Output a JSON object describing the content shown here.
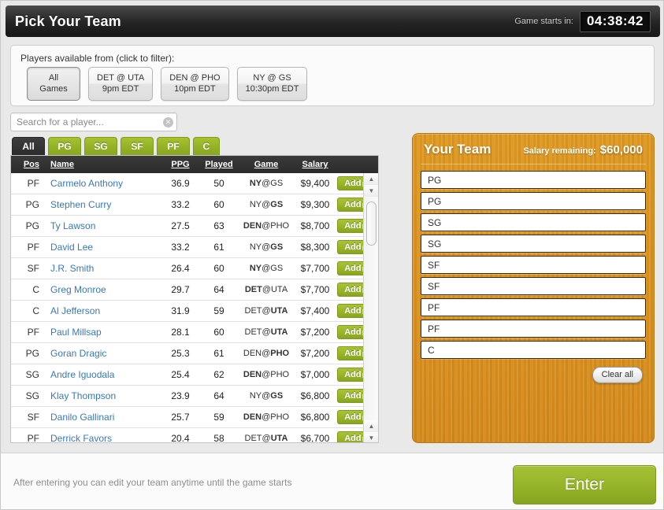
{
  "header": {
    "title": "Pick Your Team",
    "timer_label": "Game starts in:",
    "timer_value": "04:38:42"
  },
  "games_filter": {
    "label": "Players available from (click to filter):",
    "buttons": [
      {
        "line1": "All",
        "line2": "Games",
        "active": true
      },
      {
        "line1": "DET @ UTA",
        "line2": "9pm EDT",
        "active": false
      },
      {
        "line1": "DEN @ PHO",
        "line2": "10pm EDT",
        "active": false
      },
      {
        "line1": "NY @ GS",
        "line2": "10:30pm EDT",
        "active": false
      }
    ]
  },
  "search": {
    "placeholder": "Search for a player...",
    "value": "",
    "clear_icon": "clear-icon"
  },
  "position_tabs": [
    {
      "label": "All",
      "active": true
    },
    {
      "label": "PG",
      "active": false
    },
    {
      "label": "SG",
      "active": false
    },
    {
      "label": "SF",
      "active": false
    },
    {
      "label": "PF",
      "active": false
    },
    {
      "label": "C",
      "active": false
    }
  ],
  "table": {
    "columns": [
      "Pos",
      "Name",
      "PPG",
      "Played",
      "Game",
      "Salary"
    ],
    "add_label": "Add",
    "rows": [
      {
        "pos": "PF",
        "name": "Carmelo Anthony",
        "ppg": "36.9",
        "played": "50",
        "game_away": "NY",
        "game_home": "GS",
        "bold": "away",
        "salary": "$9,400"
      },
      {
        "pos": "PG",
        "name": "Stephen Curry",
        "ppg": "33.2",
        "played": "60",
        "game_away": "NY",
        "game_home": "GS",
        "bold": "home",
        "salary": "$9,300"
      },
      {
        "pos": "PG",
        "name": "Ty Lawson",
        "ppg": "27.5",
        "played": "63",
        "game_away": "DEN",
        "game_home": "PHO",
        "bold": "away",
        "salary": "$8,700"
      },
      {
        "pos": "PF",
        "name": "David Lee",
        "ppg": "33.2",
        "played": "61",
        "game_away": "NY",
        "game_home": "GS",
        "bold": "home",
        "salary": "$8,300"
      },
      {
        "pos": "SF",
        "name": "J.R. Smith",
        "ppg": "26.4",
        "played": "60",
        "game_away": "NY",
        "game_home": "GS",
        "bold": "away",
        "salary": "$7,700"
      },
      {
        "pos": "C",
        "name": "Greg Monroe",
        "ppg": "29.7",
        "played": "64",
        "game_away": "DET",
        "game_home": "UTA",
        "bold": "away",
        "salary": "$7,700"
      },
      {
        "pos": "C",
        "name": "Al Jefferson",
        "ppg": "31.9",
        "played": "59",
        "game_away": "DET",
        "game_home": "UTA",
        "bold": "home",
        "salary": "$7,400"
      },
      {
        "pos": "PF",
        "name": "Paul Millsap",
        "ppg": "28.1",
        "played": "60",
        "game_away": "DET",
        "game_home": "UTA",
        "bold": "home",
        "salary": "$7,200"
      },
      {
        "pos": "PG",
        "name": "Goran Dragic",
        "ppg": "25.3",
        "played": "61",
        "game_away": "DEN",
        "game_home": "PHO",
        "bold": "home",
        "salary": "$7,200"
      },
      {
        "pos": "SG",
        "name": "Andre Iguodala",
        "ppg": "25.4",
        "played": "62",
        "game_away": "DEN",
        "game_home": "PHO",
        "bold": "away",
        "salary": "$7,000"
      },
      {
        "pos": "SG",
        "name": "Klay Thompson",
        "ppg": "23.9",
        "played": "64",
        "game_away": "NY",
        "game_home": "GS",
        "bold": "home",
        "salary": "$6,800"
      },
      {
        "pos": "SF",
        "name": "Danilo Gallinari",
        "ppg": "25.7",
        "played": "59",
        "game_away": "DEN",
        "game_home": "PHO",
        "bold": "away",
        "salary": "$6,800"
      },
      {
        "pos": "PF",
        "name": "Derrick Favors",
        "ppg": "20.4",
        "played": "58",
        "game_away": "DET",
        "game_home": "UTA",
        "bold": "home",
        "salary": "$6,700"
      }
    ]
  },
  "your_team": {
    "title": "Your Team",
    "salary_label": "Salary remaining:",
    "salary_value": "$60,000",
    "slots": [
      "PG",
      "PG",
      "SG",
      "SG",
      "SF",
      "SF",
      "PF",
      "PF",
      "C"
    ],
    "clear_all_label": "Clear all"
  },
  "footer": {
    "note": "After entering you can edit your team anytime until the game starts",
    "enter_label": "Enter"
  },
  "colors": {
    "accent_green": "#96b42a",
    "wood_orange": "#dd9320",
    "link_blue": "#3a78b5",
    "header_dark": "#2b2b2b"
  }
}
